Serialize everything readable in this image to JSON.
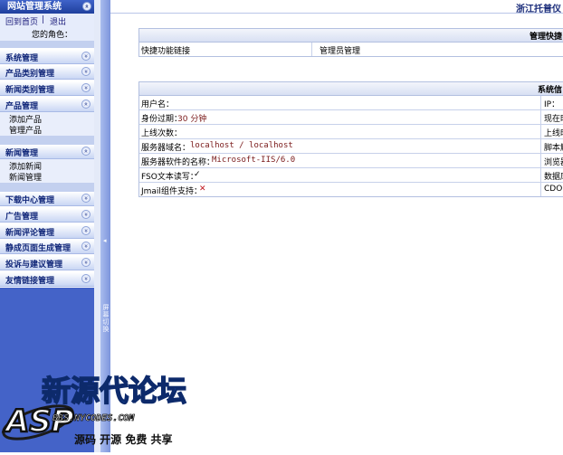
{
  "sidebar": {
    "title": "网站管理系统",
    "links": {
      "home": "回到首页",
      "sep": "|",
      "logout": "退出"
    },
    "role_label": "您的角色：",
    "menus": [
      {
        "label": "系统管理"
      },
      {
        "label": "产品类别管理"
      },
      {
        "label": "新闻类别管理"
      },
      {
        "label": "产品管理",
        "items": [
          "添加产品",
          "管理产品"
        ]
      },
      {
        "label": "新闻管理",
        "items": [
          "添加新闻",
          "新闻管理"
        ]
      },
      {
        "label": "下载中心管理"
      },
      {
        "label": "广告管理"
      },
      {
        "label": "新闻评论管理"
      },
      {
        "label": "静成页面生成管理"
      },
      {
        "label": "投诉与建议管理"
      },
      {
        "label": "友情链接管理"
      }
    ],
    "chevron_glyph": "»",
    "split_text": "屏幕切换",
    "split_arrow": "◂"
  },
  "main": {
    "top_title": "浙江托普仪",
    "quick": {
      "header": "管理快捷",
      "col1": "快捷功能链接",
      "col2": "管理员管理"
    },
    "system": {
      "header": "系统信",
      "rows": [
        {
          "label": "用户名：",
          "value": "",
          "right": "IP："
        },
        {
          "label": "身份过期：",
          "value": "30 分钟",
          "right": "现在时"
        },
        {
          "label": "上线次数：",
          "value": "",
          "right": "上线时"
        },
        {
          "label": "服务器域名：",
          "value": "localhost / localhost",
          "right": "脚本解"
        },
        {
          "label": "服务器软件的名称：",
          "value": "Microsoft-IIS/6.0",
          "right": "浏览器"
        },
        {
          "label": "FSO文本读写：",
          "value": "✓",
          "right": "数据库"
        },
        {
          "label": "Jmail组件支持：",
          "value": "✕",
          "right": "CDONT"
        }
      ]
    }
  },
  "watermark": {
    "logo": "ASP",
    "title": "新源代论坛",
    "url": "BBS.NYCODES.COM",
    "slogan": "源码 开源 免费 共享"
  },
  "colors": {
    "nav_dark": "#1f3f9d",
    "sidebar_light": "#e6ecfb",
    "sidebar_bottom": "#4463c8",
    "accent_red": "#c0141c"
  }
}
